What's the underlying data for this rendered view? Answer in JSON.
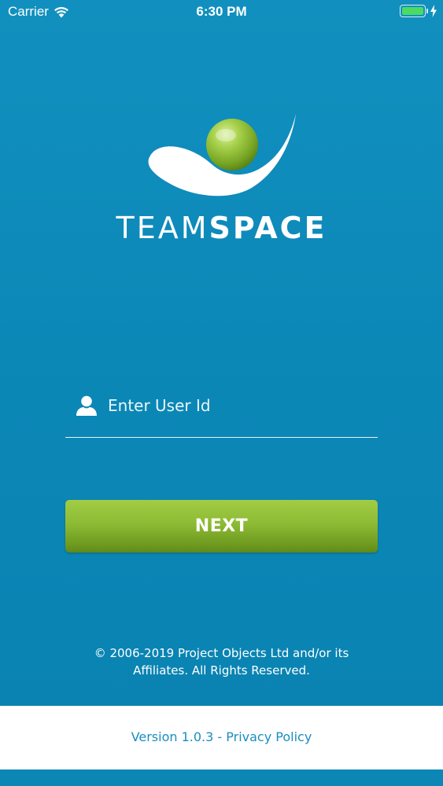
{
  "status_bar": {
    "carrier": "Carrier",
    "time": "6:30 PM",
    "battery_color": "#4cd964",
    "icons": [
      "wifi-icon",
      "battery-icon",
      "charging-bolt-icon"
    ]
  },
  "brand": {
    "name_light": "TEAM",
    "name_bold": "SPACE",
    "ball_color": "#8fbd35"
  },
  "login": {
    "user_id_placeholder": "Enter User Id",
    "user_id_value": "",
    "user_icon": "user-icon",
    "next_label": "NEXT"
  },
  "copyright": {
    "line1": "© 2006-2019 Project Objects Ltd and/or its",
    "line2": "Affiliates. All Rights Reserved."
  },
  "footer": {
    "version": "Version 1.0.3",
    "separator": " - ",
    "privacy_label": "Privacy Policy"
  },
  "colors": {
    "background": "#0e89b8",
    "button_green": "#8dbb34",
    "footer_link": "#1a8ec0"
  }
}
